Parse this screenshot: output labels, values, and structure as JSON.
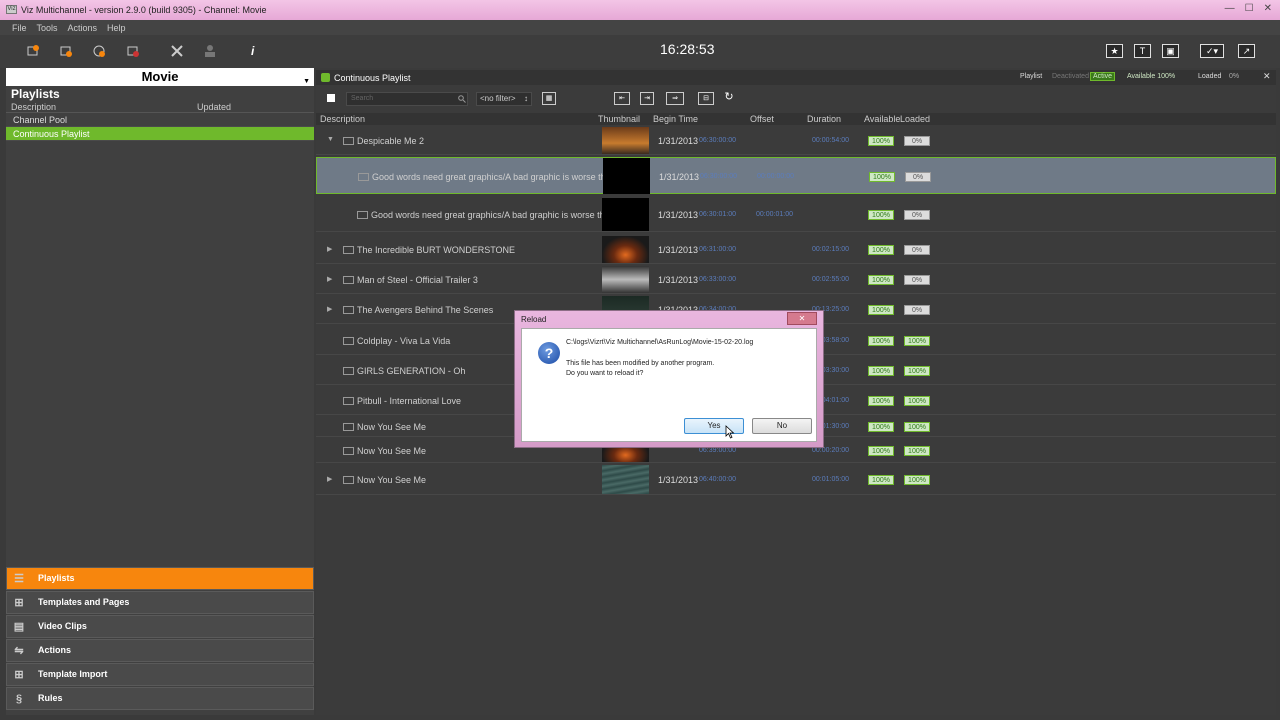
{
  "window": {
    "title": "Viz Multichannel - version 2.9.0 (build 9305) - Channel: Movie",
    "icon_text": "Viz"
  },
  "menu": [
    "File",
    "Tools",
    "Actions",
    "Help"
  ],
  "toolbar": {
    "clock": "16:28:53",
    "info_glyph": "i"
  },
  "left_panel": {
    "channel": "Movie",
    "section_title": "Playlists",
    "columns": {
      "description": "Description",
      "updated": "Updated"
    },
    "playlists": [
      "Channel Pool",
      "Continuous Playlist"
    ],
    "selected_index": 1
  },
  "nav": [
    {
      "label": "Playlists",
      "icon": "playlist-icon",
      "active": true
    },
    {
      "label": "Templates and Pages",
      "icon": "grid-icon",
      "active": false
    },
    {
      "label": "Video Clips",
      "icon": "film-icon",
      "active": false
    },
    {
      "label": "Actions",
      "icon": "actions-icon",
      "active": false
    },
    {
      "label": "Template Import",
      "icon": "grid-icon",
      "active": false
    },
    {
      "label": "Rules",
      "icon": "section-icon",
      "active": false
    }
  ],
  "playlist": {
    "title": "Continuous Playlist",
    "status": {
      "playlist": "Playlist",
      "deactivated": "Deactivated",
      "active": "Active",
      "available": "Available 100%",
      "loaded": "Loaded",
      "loaded_pct": "0%"
    },
    "search_placeholder": "Search",
    "filter": "<no filter>",
    "columns": {
      "description": "Description",
      "thumbnail": "Thumbnail",
      "begin": "Begin Time",
      "offset": "Offset",
      "duration": "Duration",
      "available": "Available",
      "loaded": "Loaded"
    },
    "rows": [
      {
        "desc": "Despicable Me 2",
        "date": "1/31/2013",
        "time": "06:30:00:00",
        "offset": "",
        "duration": "00:00:54:00",
        "available": "100%",
        "loaded": "0%",
        "expand": "▼",
        "thumb": "orange"
      },
      {
        "desc": "Good words need great graphics/A bad graphic is worse th...",
        "date": "1/31/2013",
        "time": "06:30:00:00",
        "offset": "00:00:00:00",
        "duration": "",
        "available": "100%",
        "loaded": "0%",
        "expand": "",
        "thumb": "black"
      },
      {
        "desc": "Good words need great graphics/A bad graphic is worse th...",
        "date": "1/31/2013",
        "time": "06:30:01:00",
        "offset": "00:00:01:00",
        "duration": "",
        "available": "100%",
        "loaded": "0%",
        "expand": "",
        "thumb": "black"
      },
      {
        "desc": "The Incredible BURT WONDERSTONE",
        "date": "1/31/2013",
        "time": "06:31:00:00",
        "offset": "",
        "duration": "00:02:15:00",
        "available": "100%",
        "loaded": "0%",
        "expand": "▶",
        "thumb": "sunset"
      },
      {
        "desc": "Man of Steel - Official Trailer 3",
        "date": "1/31/2013",
        "time": "06:33:00:00",
        "offset": "",
        "duration": "00:02:55:00",
        "available": "100%",
        "loaded": "0%",
        "expand": "▶",
        "thumb": "gray"
      },
      {
        "desc": "The Avengers Behind The Scenes",
        "date": "1/31/2013",
        "time": "06:34:00:00",
        "offset": "",
        "duration": "00:13:25:00",
        "available": "100%",
        "loaded": "0%",
        "expand": "▶",
        "thumb": "dark"
      },
      {
        "desc": "Coldplay - Viva La Vida",
        "date": "",
        "time": "",
        "offset": "",
        "duration": "00:03:58:00",
        "available": "100%",
        "loaded": "100%",
        "expand": "",
        "thumb": ""
      },
      {
        "desc": "GIRLS GENERATION - Oh",
        "date": "",
        "time": "",
        "offset": "",
        "duration": "00:03:30:00",
        "available": "100%",
        "loaded": "100%",
        "expand": "",
        "thumb": ""
      },
      {
        "desc": "Pitbull - International Love",
        "date": "",
        "time": "",
        "offset": "",
        "duration": "00:04:01:00",
        "available": "100%",
        "loaded": "100%",
        "expand": "",
        "thumb": ""
      },
      {
        "desc": "Now You See Me",
        "date": "",
        "time": "",
        "offset": "",
        "duration": "00:01:30:00",
        "available": "100%",
        "loaded": "100%",
        "expand": "",
        "thumb": ""
      },
      {
        "desc": "Now You See Me",
        "date": "",
        "time": "06:39:00:00",
        "offset": "",
        "duration": "00:00:20:00",
        "available": "100%",
        "loaded": "100%",
        "expand": "",
        "thumb": "sunset"
      },
      {
        "desc": "Now You See Me",
        "date": "1/31/2013",
        "time": "06:40:00:00",
        "offset": "",
        "duration": "00:01:05:00",
        "available": "100%",
        "loaded": "100%",
        "expand": "▶",
        "thumb": "teal"
      }
    ]
  },
  "dialog": {
    "title": "Reload",
    "close": "✕",
    "path": "C:\\logs\\Vizrt\\Viz Multichannel\\AsRunLog\\Movie-15-02-20.log",
    "line1": "This file has been modified by another program.",
    "line2": "Do you want to reload it?",
    "yes": "Yes",
    "no": "No"
  }
}
